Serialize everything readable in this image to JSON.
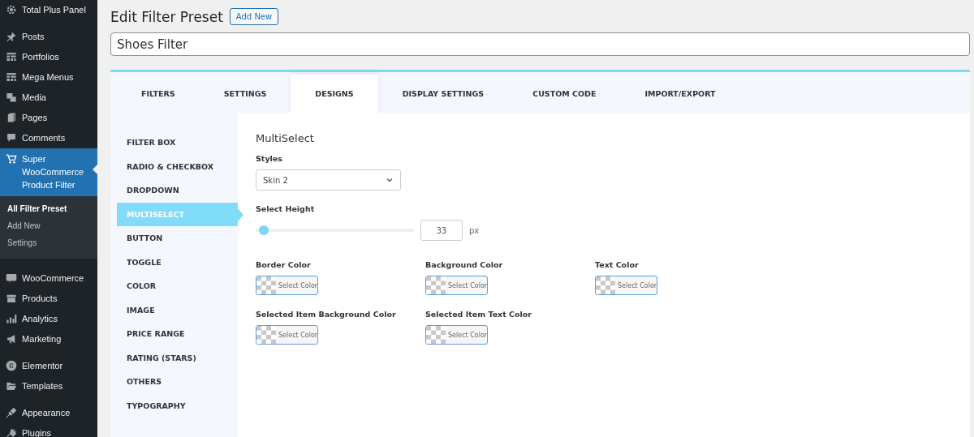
{
  "sidebar": {
    "groups": [
      {
        "items": [
          {
            "label": "Total Plus Panel",
            "selected": false
          }
        ]
      },
      {
        "items": [
          {
            "label": "Posts",
            "selected": false
          },
          {
            "label": "Portfolios",
            "selected": false
          },
          {
            "label": "Mega Menus",
            "selected": false
          },
          {
            "label": "Media",
            "selected": false
          },
          {
            "label": "Pages",
            "selected": false
          },
          {
            "label": "Comments",
            "selected": false
          },
          {
            "label": "Super WooCommerce Product Filter",
            "selected": true,
            "children": [
              {
                "label": "All Filter Preset",
                "selected": true
              },
              {
                "label": "Add New",
                "selected": false
              },
              {
                "label": "Settings",
                "selected": false
              }
            ]
          }
        ]
      },
      {
        "items": [
          {
            "label": "WooCommerce",
            "selected": false
          },
          {
            "label": "Products",
            "selected": false
          },
          {
            "label": "Analytics",
            "selected": false
          },
          {
            "label": "Marketing",
            "selected": false
          }
        ]
      },
      {
        "items": [
          {
            "label": "Elementor",
            "selected": false
          },
          {
            "label": "Templates",
            "selected": false
          }
        ]
      },
      {
        "items": [
          {
            "label": "Appearance",
            "selected": false
          },
          {
            "label": "Plugins",
            "selected": false
          }
        ]
      }
    ]
  },
  "page": {
    "title": "Edit Filter Preset",
    "add_new": "Add New",
    "name_value": "Shoes Filter"
  },
  "tabs": [
    {
      "label": "FILTERS",
      "selected": false
    },
    {
      "label": "SETTINGS",
      "selected": false
    },
    {
      "label": "DESIGNS",
      "selected": true
    },
    {
      "label": "DISPLAY SETTINGS",
      "selected": false
    },
    {
      "label": "CUSTOM CODE",
      "selected": false
    },
    {
      "label": "IMPORT/EXPORT",
      "selected": false
    }
  ],
  "design_nav": [
    {
      "label": "FILTER BOX",
      "selected": false
    },
    {
      "label": "RADIO & CHECKBOX",
      "selected": false
    },
    {
      "label": "DROPDOWN",
      "selected": false
    },
    {
      "label": "MULTISELECT",
      "selected": true
    },
    {
      "label": "BUTTON",
      "selected": false
    },
    {
      "label": "TOGGLE",
      "selected": false
    },
    {
      "label": "COLOR",
      "selected": false
    },
    {
      "label": "IMAGE",
      "selected": false
    },
    {
      "label": "PRICE RANGE",
      "selected": false
    },
    {
      "label": "RATING (STARS)",
      "selected": false
    },
    {
      "label": "OTHERS",
      "selected": false
    },
    {
      "label": "TYPOGRAPHY",
      "selected": false
    }
  ],
  "section": {
    "title": "MultiSelect",
    "styles_label": "Styles",
    "styles_value": "Skin 2",
    "height_label": "Select Height",
    "height": {
      "level": 0.02,
      "value": "33",
      "unit": "px"
    },
    "color_rows": [
      [
        {
          "label": "Border Color",
          "button": "Select Color"
        },
        {
          "label": "Background Color",
          "button": "Select Color"
        },
        {
          "label": "Text Color",
          "button": "Select Color"
        }
      ],
      [
        {
          "label": "Selected Item Background Color",
          "button": "Select Color"
        },
        {
          "label": "Selected Item Text Color",
          "button": "Select Color"
        }
      ]
    ]
  }
}
